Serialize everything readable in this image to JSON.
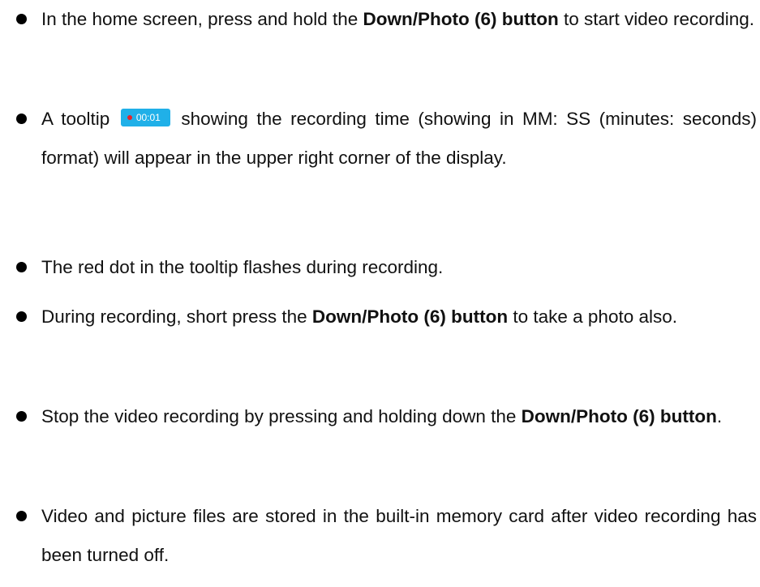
{
  "items": [
    {
      "pre": "In the home screen, press and hold the ",
      "bold": "Down/Photo (6) button",
      "post": " to start video recording."
    },
    {
      "pre": "A tooltip",
      "tooltip_time": "00:01",
      "post": "showing the recording time (showing in MM: SS (minutes: seconds) format) will appear in the upper right corner of the display."
    },
    {
      "text": "The red dot in the tooltip flashes during recording."
    },
    {
      "pre": "During recording, short press the ",
      "bold": "Down/Photo (6) button",
      "post": " to take a photo also."
    },
    {
      "pre": "Stop the video recording by pressing and holding down the ",
      "bold": "Down/Photo (6) button",
      "post": "."
    },
    {
      "text": "Video and picture files are stored in the built-in memory card after video recording has been turned off."
    }
  ],
  "colors": {
    "tooltip_bg": "#20b0e8",
    "record_dot": "#e8232a"
  }
}
